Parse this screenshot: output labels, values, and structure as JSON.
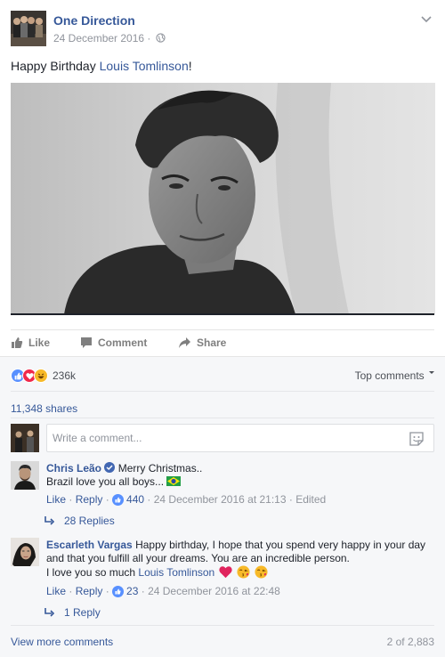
{
  "post": {
    "page_name": "One Direction",
    "date": "24 December 2016",
    "meta_sep": "·",
    "text_prefix": "Happy Birthday ",
    "text_link": "Louis Tomlinson",
    "text_suffix": "!",
    "icons": {
      "privacy": "globe-icon",
      "menu": "chevron-down-icon"
    }
  },
  "actions": {
    "like": "Like",
    "comment": "Comment",
    "share": "Share"
  },
  "ufi": {
    "reaction_count": "236k",
    "top_comments": "Top comments",
    "shares": "11,348 shares",
    "comment_placeholder": "Write a comment...",
    "view_more": "View more comments",
    "count_of": "2 of 2,883"
  },
  "comments": [
    {
      "author": "Chris Leão",
      "text_line1": "Merry Christmas..",
      "text_line2": "Brazil love you all boys...",
      "like": "Like",
      "reply": "Reply",
      "likes": "440",
      "timestamp": "24 December 2016 at 21:13",
      "edited": "Edited",
      "replies": "28 Replies"
    },
    {
      "author": "Escarleth Vargas",
      "text": "Happy birthday, I hope that you spend very happy in your day and that you fulfill all your dreams. You are an incredible person.",
      "text_line3_prefix": "I love you so much ",
      "text_line3_link": "Louis Tomlinson",
      "like": "Like",
      "reply": "Reply",
      "likes": "23",
      "timestamp": "24 December 2016 at 22:48",
      "replies": "1 Reply"
    }
  ],
  "colors": {
    "link": "#365899",
    "muted": "#90949c",
    "like_blue": "#5890ff",
    "love_red": "#f0284a",
    "haha_yellow": "#f7b928"
  }
}
